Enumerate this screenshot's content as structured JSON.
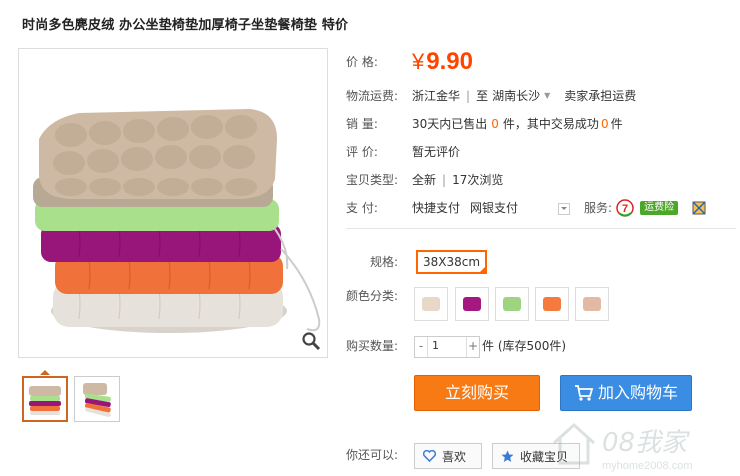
{
  "product": {
    "title": "时尚多色麂皮绒 办公坐垫椅垫加厚椅子坐垫餐椅垫 特价"
  },
  "price": {
    "label": "价  格:",
    "currency": "¥",
    "value": "9.90"
  },
  "shipping": {
    "label": "物流运费:",
    "from": "浙江金华",
    "to_prefix": "至",
    "to": "湖南长沙",
    "note": "卖家承担运费"
  },
  "sales": {
    "label": "销  量:",
    "prefix": "30天内已售出",
    "sold": "0",
    "mid": "件，其中交易成功",
    "success": "0",
    "suffix": "件"
  },
  "reviews": {
    "label": "评  价:",
    "value": "暂无评价"
  },
  "item_type": {
    "label": "宝贝类型:",
    "condition": "全新",
    "views": "17次浏览"
  },
  "payment": {
    "label": "支  付:",
    "methods": [
      "快捷支付",
      "网银支付"
    ],
    "service_label": "服务:",
    "service_badge": "运费险"
  },
  "spec": {
    "label": "规格:",
    "selected": "38X38cm"
  },
  "colors": {
    "label": "颜色分类:",
    "swatches": [
      "#e8d8c8",
      "#a3197f",
      "#9ed47f",
      "#f47a3e",
      "#e2b9a4"
    ]
  },
  "quantity": {
    "label": "购买数量:",
    "minus": "-",
    "value": "1",
    "plus": "+",
    "stock_text": "件 (库存500件)"
  },
  "buttons": {
    "buy_now": "立刻购买",
    "add_to_cart": "加入购物车"
  },
  "extra": {
    "label": "你还可以:",
    "like": "喜欢",
    "favorite": "收藏宝贝"
  },
  "watermark": {
    "text1": "08我家",
    "text2": "myhome2008.com"
  },
  "colors_theme": {
    "accent": "#ff4400",
    "buy": "#f77a14",
    "cart": "#3b8de3",
    "badge": "#4ca62a"
  }
}
